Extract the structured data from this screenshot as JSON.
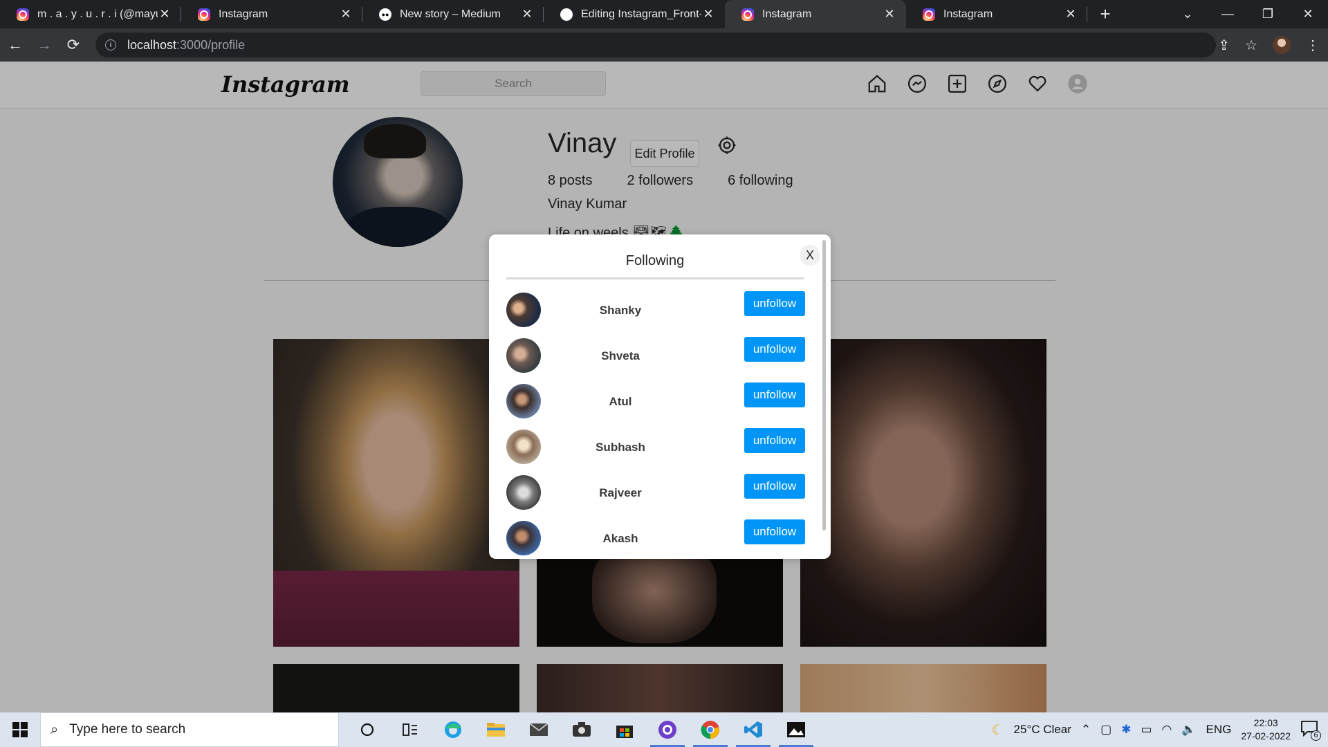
{
  "browser": {
    "tabs": [
      {
        "title": "m . a . y . u . r . i (@mayuriw",
        "icon": "instagram-icon"
      },
      {
        "title": "Instagram",
        "icon": "instagram-icon"
      },
      {
        "title": "New story – Medium",
        "icon": "medium-icon"
      },
      {
        "title": "Editing Instagram_Front-en",
        "icon": "github-icon"
      },
      {
        "title": "Instagram",
        "icon": "instagram-icon"
      },
      {
        "title": "Instagram",
        "icon": "instagram-icon"
      }
    ],
    "active_tab": 4,
    "url_host": "localhost",
    "url_path": ":3000/profile"
  },
  "app": {
    "logo": "Instagram",
    "search_placeholder": "Search"
  },
  "profile": {
    "username": "Vinay",
    "edit_label": "Edit Profile",
    "stats": {
      "posts": "8 posts",
      "followers": "2 followers",
      "following": "6 following"
    },
    "full_name": "Vinay Kumar",
    "bio": "Life on weels 🛣🗺🌲"
  },
  "modal": {
    "title": "Following",
    "close_label": "X",
    "users": [
      {
        "name": "Shanky",
        "action": "unfollow"
      },
      {
        "name": "Shveta",
        "action": "unfollow"
      },
      {
        "name": "Atul",
        "action": "unfollow"
      },
      {
        "name": "Subhash",
        "action": "unfollow"
      },
      {
        "name": "Rajveer",
        "action": "unfollow"
      },
      {
        "name": "Akash",
        "action": "unfollow"
      }
    ]
  },
  "taskbar": {
    "search_placeholder": "Type here to search",
    "weather": "25°C  Clear",
    "language": "ENG",
    "time": "22:03",
    "date": "27-02-2022",
    "notification_count": "6"
  },
  "colors": {
    "accent": "#0095f6",
    "chrome_dark": "#202124",
    "chrome_toolbar": "#35363a"
  }
}
